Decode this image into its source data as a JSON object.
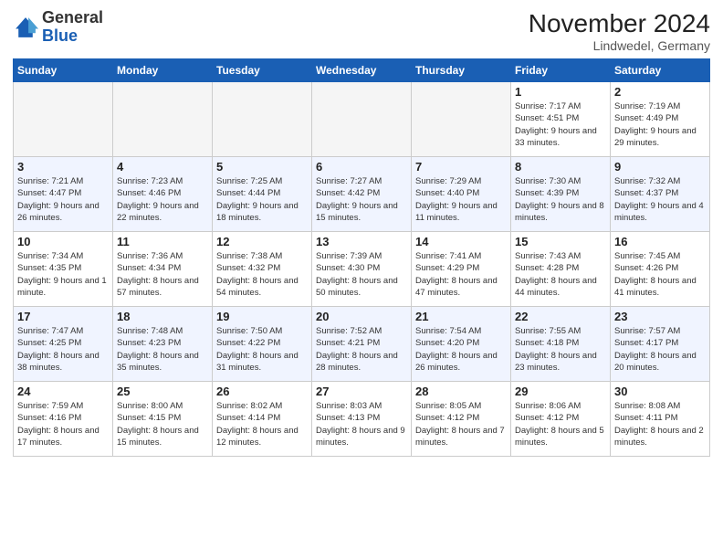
{
  "logo": {
    "text_general": "General",
    "text_blue": "Blue"
  },
  "title": "November 2024",
  "location": "Lindwedel, Germany",
  "days_of_week": [
    "Sunday",
    "Monday",
    "Tuesday",
    "Wednesday",
    "Thursday",
    "Friday",
    "Saturday"
  ],
  "weeks": [
    [
      {
        "day": "",
        "empty": true
      },
      {
        "day": "",
        "empty": true
      },
      {
        "day": "",
        "empty": true
      },
      {
        "day": "",
        "empty": true
      },
      {
        "day": "",
        "empty": true
      },
      {
        "day": "1",
        "sunrise": "7:17 AM",
        "sunset": "4:51 PM",
        "daylight": "9 hours and 33 minutes."
      },
      {
        "day": "2",
        "sunrise": "7:19 AM",
        "sunset": "4:49 PM",
        "daylight": "9 hours and 29 minutes."
      }
    ],
    [
      {
        "day": "3",
        "sunrise": "7:21 AM",
        "sunset": "4:47 PM",
        "daylight": "9 hours and 26 minutes."
      },
      {
        "day": "4",
        "sunrise": "7:23 AM",
        "sunset": "4:46 PM",
        "daylight": "9 hours and 22 minutes."
      },
      {
        "day": "5",
        "sunrise": "7:25 AM",
        "sunset": "4:44 PM",
        "daylight": "9 hours and 18 minutes."
      },
      {
        "day": "6",
        "sunrise": "7:27 AM",
        "sunset": "4:42 PM",
        "daylight": "9 hours and 15 minutes."
      },
      {
        "day": "7",
        "sunrise": "7:29 AM",
        "sunset": "4:40 PM",
        "daylight": "9 hours and 11 minutes."
      },
      {
        "day": "8",
        "sunrise": "7:30 AM",
        "sunset": "4:39 PM",
        "daylight": "9 hours and 8 minutes."
      },
      {
        "day": "9",
        "sunrise": "7:32 AM",
        "sunset": "4:37 PM",
        "daylight": "9 hours and 4 minutes."
      }
    ],
    [
      {
        "day": "10",
        "sunrise": "7:34 AM",
        "sunset": "4:35 PM",
        "daylight": "9 hours and 1 minute."
      },
      {
        "day": "11",
        "sunrise": "7:36 AM",
        "sunset": "4:34 PM",
        "daylight": "8 hours and 57 minutes."
      },
      {
        "day": "12",
        "sunrise": "7:38 AM",
        "sunset": "4:32 PM",
        "daylight": "8 hours and 54 minutes."
      },
      {
        "day": "13",
        "sunrise": "7:39 AM",
        "sunset": "4:30 PM",
        "daylight": "8 hours and 50 minutes."
      },
      {
        "day": "14",
        "sunrise": "7:41 AM",
        "sunset": "4:29 PM",
        "daylight": "8 hours and 47 minutes."
      },
      {
        "day": "15",
        "sunrise": "7:43 AM",
        "sunset": "4:28 PM",
        "daylight": "8 hours and 44 minutes."
      },
      {
        "day": "16",
        "sunrise": "7:45 AM",
        "sunset": "4:26 PM",
        "daylight": "8 hours and 41 minutes."
      }
    ],
    [
      {
        "day": "17",
        "sunrise": "7:47 AM",
        "sunset": "4:25 PM",
        "daylight": "8 hours and 38 minutes."
      },
      {
        "day": "18",
        "sunrise": "7:48 AM",
        "sunset": "4:23 PM",
        "daylight": "8 hours and 35 minutes."
      },
      {
        "day": "19",
        "sunrise": "7:50 AM",
        "sunset": "4:22 PM",
        "daylight": "8 hours and 31 minutes."
      },
      {
        "day": "20",
        "sunrise": "7:52 AM",
        "sunset": "4:21 PM",
        "daylight": "8 hours and 28 minutes."
      },
      {
        "day": "21",
        "sunrise": "7:54 AM",
        "sunset": "4:20 PM",
        "daylight": "8 hours and 26 minutes."
      },
      {
        "day": "22",
        "sunrise": "7:55 AM",
        "sunset": "4:18 PM",
        "daylight": "8 hours and 23 minutes."
      },
      {
        "day": "23",
        "sunrise": "7:57 AM",
        "sunset": "4:17 PM",
        "daylight": "8 hours and 20 minutes."
      }
    ],
    [
      {
        "day": "24",
        "sunrise": "7:59 AM",
        "sunset": "4:16 PM",
        "daylight": "8 hours and 17 minutes."
      },
      {
        "day": "25",
        "sunrise": "8:00 AM",
        "sunset": "4:15 PM",
        "daylight": "8 hours and 15 minutes."
      },
      {
        "day": "26",
        "sunrise": "8:02 AM",
        "sunset": "4:14 PM",
        "daylight": "8 hours and 12 minutes."
      },
      {
        "day": "27",
        "sunrise": "8:03 AM",
        "sunset": "4:13 PM",
        "daylight": "8 hours and 9 minutes."
      },
      {
        "day": "28",
        "sunrise": "8:05 AM",
        "sunset": "4:12 PM",
        "daylight": "8 hours and 7 minutes."
      },
      {
        "day": "29",
        "sunrise": "8:06 AM",
        "sunset": "4:12 PM",
        "daylight": "8 hours and 5 minutes."
      },
      {
        "day": "30",
        "sunrise": "8:08 AM",
        "sunset": "4:11 PM",
        "daylight": "8 hours and 2 minutes."
      }
    ]
  ],
  "labels": {
    "sunrise": "Sunrise:",
    "sunset": "Sunset:",
    "daylight": "Daylight:"
  }
}
